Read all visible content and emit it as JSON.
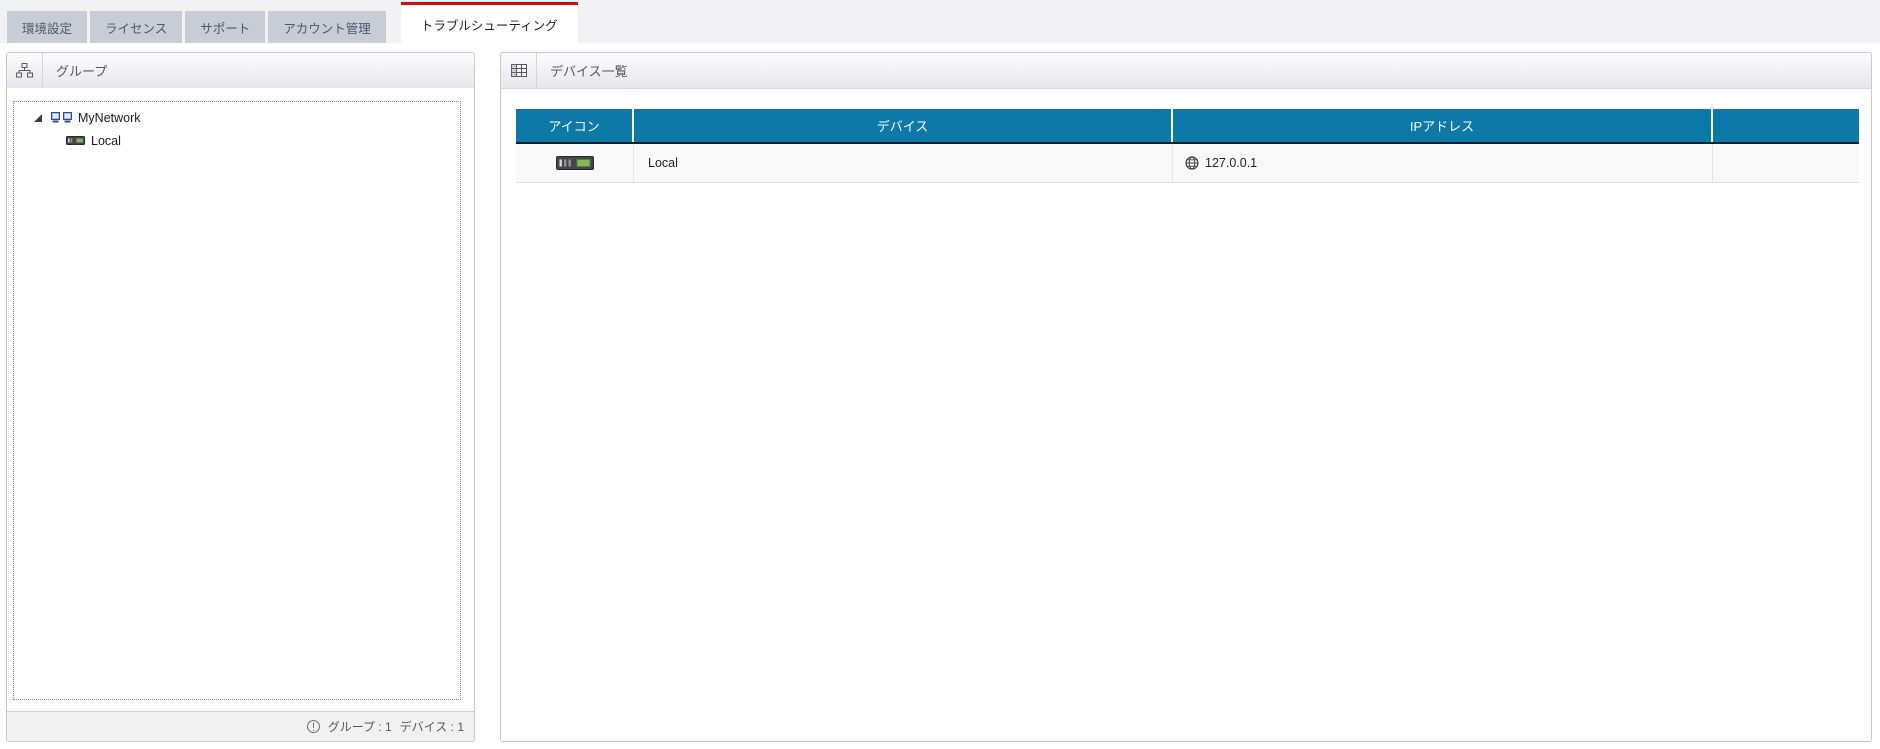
{
  "tabs": [
    {
      "label": "環境設定",
      "active": false
    },
    {
      "label": "ライセンス",
      "active": false
    },
    {
      "label": "サポート",
      "active": false
    },
    {
      "label": "アカウント管理",
      "active": false
    },
    {
      "label": "トラブルシューティング",
      "active": true
    }
  ],
  "colors": {
    "active_tab_accent": "#d40b0b",
    "inactive_tab_bg": "#c8cdd5",
    "table_header_bg": "#0d79a8"
  },
  "group_panel": {
    "title": "グループ",
    "header_icon": "sitemap-icon",
    "tree": [
      {
        "label": "MyNetwork",
        "level": 0,
        "expanded": true,
        "icon": "network-computers-icon"
      },
      {
        "label": "Local",
        "level": 1,
        "icon": "rack-server-icon"
      }
    ],
    "status": {
      "icon": "info-icon",
      "groups": "グループ : 1",
      "devices": "デバイス : 1"
    }
  },
  "device_panel": {
    "title": "デバイス一覧",
    "header_icon": "table-grid-icon",
    "table": {
      "columns": [
        "アイコン",
        "デバイス",
        "IPアドレス"
      ],
      "rows": [
        {
          "icon": "rack-server-icon",
          "device": "Local",
          "ip_icon": "globe-icon",
          "ip": "127.0.0.1"
        }
      ]
    }
  }
}
